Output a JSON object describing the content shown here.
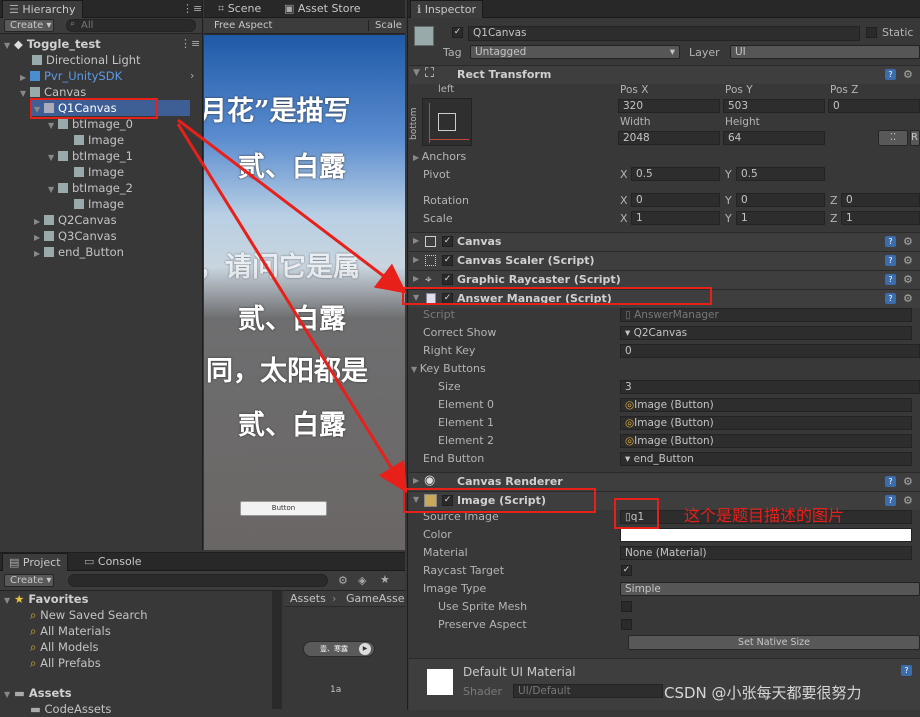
{
  "hierarchy": {
    "tab": "Hierarchy",
    "create": "Create",
    "search_placeholder": "All",
    "root": "Toggle_test",
    "items": [
      "Directional Light",
      "Pvr_UnitySDK",
      "Canvas",
      "Q1Canvas",
      "btImage_0",
      "Image",
      "btImage_1",
      "Image",
      "btImage_2",
      "Image",
      "Q2Canvas",
      "Q3Canvas",
      "end_Button"
    ]
  },
  "scene": {
    "tabs": [
      "Scene",
      "Asset Store",
      "Scale"
    ],
    "aspect": "Free Aspect",
    "lines": [
      "月花”是描写",
      "贰、白露",
      "，请问它是属",
      "贰、白露",
      "同，太阳都是",
      "贰、白露"
    ],
    "button": "Button"
  },
  "project": {
    "tabs": [
      "Project",
      "Console"
    ],
    "create": "Create",
    "favorites": "Favorites",
    "fav_items": [
      "New Saved Search",
      "All Materials",
      "All Models",
      "All Prefabs"
    ],
    "assets": "Assets",
    "asset_child": "CodeAssets",
    "breadcrumb": [
      "Assets",
      "GameAsse"
    ],
    "asset_thumb_label": "壹、寒露",
    "asset_name": "1a"
  },
  "inspector": {
    "tab": "Inspector",
    "object_name": "Q1Canvas",
    "static": "Static",
    "tag_label": "Tag",
    "tag": "Untagged",
    "layer_label": "Layer",
    "layer": "UI",
    "rect": {
      "title": "Rect Transform",
      "anchor_h": "left",
      "anchor_v": "bottom",
      "labels": [
        "Pos X",
        "Pos Y",
        "Pos Z",
        "Width",
        "Height"
      ],
      "values": [
        "320",
        "503",
        "0",
        "2048",
        "64"
      ],
      "anchors": "Anchors",
      "pivot": "Pivot",
      "pivot_x": "0.5",
      "pivot_y": "0.5",
      "rotation": "Rotation",
      "rot": [
        "0",
        "0",
        "0"
      ],
      "scale": "Scale",
      "scl": [
        "1",
        "1",
        "1"
      ],
      "axis": [
        "X",
        "Y",
        "Z"
      ]
    },
    "components": [
      "Canvas",
      "Canvas Scaler (Script)",
      "Graphic Raycaster (Script)",
      "Answer Manager (Script)"
    ],
    "answer": {
      "rows": [
        [
          "Script",
          "AnswerManager"
        ],
        [
          "Correct Show",
          "Q2Canvas"
        ],
        [
          "Right Key",
          "0"
        ],
        [
          "Key Buttons",
          ""
        ],
        [
          "Size",
          "3"
        ],
        [
          "Element 0",
          "Image (Button)"
        ],
        [
          "Element 1",
          "Image (Button)"
        ],
        [
          "Element 2",
          "Image (Button)"
        ],
        [
          "End Button",
          "end_Button"
        ]
      ]
    },
    "renderer": "Canvas Renderer",
    "image": {
      "title": "Image (Script)",
      "rows": [
        "Source Image",
        "Color",
        "Material",
        "Raycast Target",
        "Image Type",
        "Use Sprite Mesh",
        "Preserve Aspect"
      ],
      "source": "q1",
      "material": "None (Material)",
      "type": "Simple",
      "native": "Set Native Size"
    },
    "material_name": "Default UI Material",
    "shader_label": "Shader",
    "shader": "UI/Default"
  },
  "annotation": "这个是题目描述的图片",
  "watermark": "CSDN @小张每天都要很努力"
}
